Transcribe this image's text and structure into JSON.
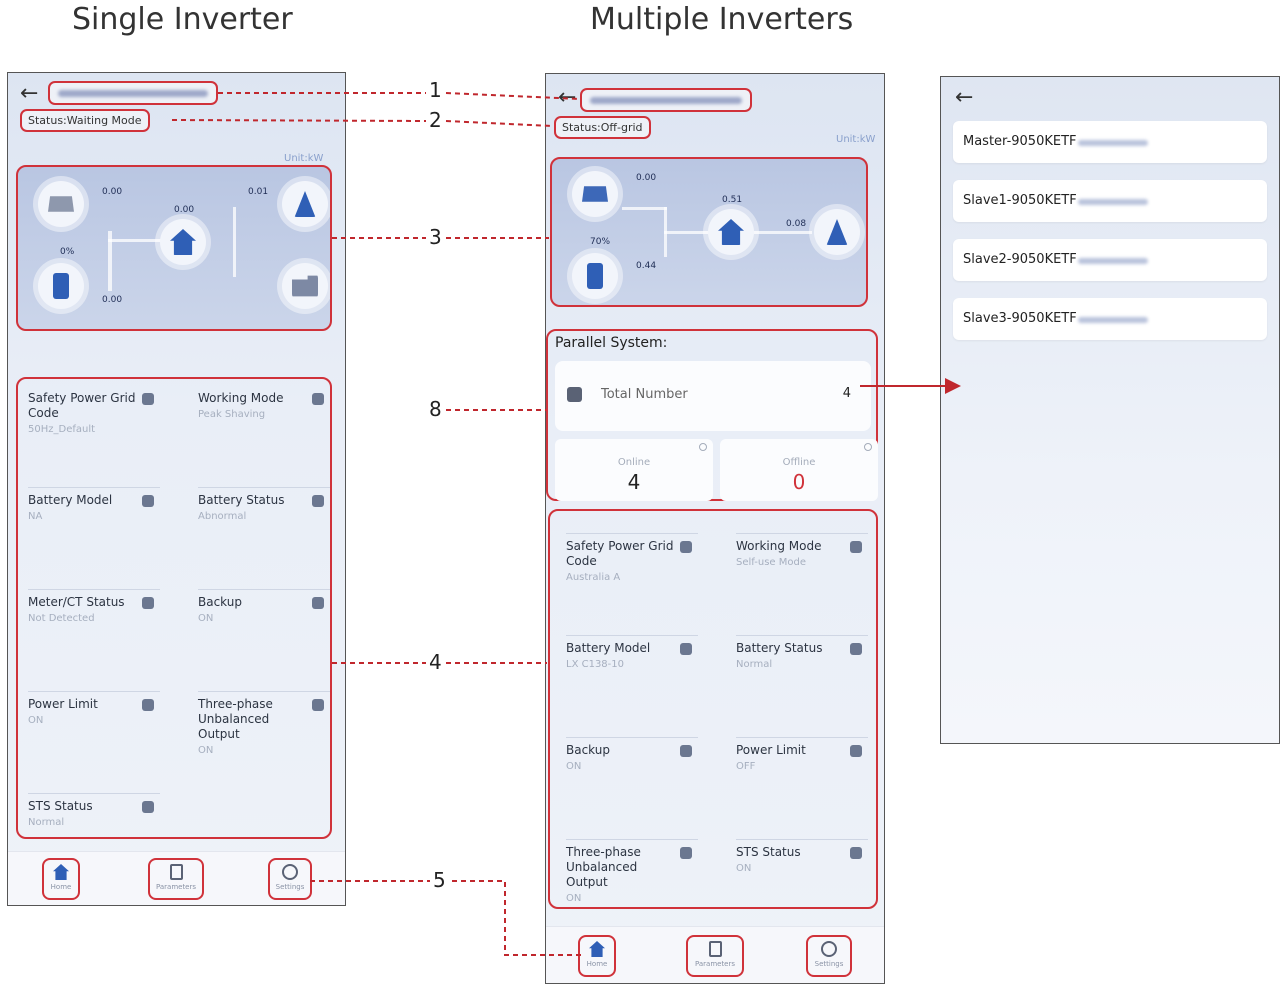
{
  "headings": {
    "single": "Single Inverter",
    "multiple": "Multiple Inverters"
  },
  "callouts": [
    "1",
    "2",
    "3",
    "8",
    "4",
    "5"
  ],
  "colors": {
    "highlight": "#d0323a",
    "accent": "#2f5fb6",
    "offline": "#d0323a"
  },
  "single": {
    "status": "Status:Waiting Mode",
    "unit": "Unit:kW",
    "flow": {
      "pv": "0.00",
      "grid": "0.01",
      "home": "0.00",
      "soc": "0%",
      "battery": "0.00"
    },
    "cards": [
      {
        "title": "Safety Power Grid Code",
        "value": "50Hz_Default",
        "icon": "shield-icon"
      },
      {
        "title": "Working Mode",
        "value": "Peak Shaving",
        "icon": "layers-icon"
      },
      {
        "title": "Battery Model",
        "value": "NA",
        "icon": "battery-icon"
      },
      {
        "title": "Battery Status",
        "value": "Abnormal",
        "icon": "battery-status-icon"
      },
      {
        "title": "Meter/CT Status",
        "value": "Not Detected",
        "icon": "meter-icon"
      },
      {
        "title": "Backup",
        "value": "ON",
        "icon": "backup-icon"
      },
      {
        "title": "Power Limit",
        "value": "ON",
        "icon": "power-limit-icon"
      },
      {
        "title": "Three-phase Unbalanced Output",
        "value": "ON",
        "icon": "three-phase-icon"
      },
      {
        "title": "STS Status",
        "value": "Normal",
        "icon": "sts-icon"
      }
    ],
    "tabs": [
      "Home",
      "Parameters",
      "Settings"
    ]
  },
  "multi": {
    "status": "Status:Off-grid",
    "unit": "Unit:kW",
    "flow": {
      "pv": "0.00",
      "soc": "70%",
      "battery": "0.44",
      "home": "0.51",
      "grid": "0.08"
    },
    "parallel": {
      "title": "Parallel System:",
      "total_label": "Total Number",
      "total_value": "4",
      "online_label": "Online",
      "online_value": "4",
      "offline_label": "Offline",
      "offline_value": "0"
    },
    "cards": [
      {
        "title": "Safety Power Grid Code",
        "value": "Australia A",
        "icon": "shield-icon"
      },
      {
        "title": "Working Mode",
        "value": "Self-use Mode",
        "icon": "layers-icon"
      },
      {
        "title": "Battery Model",
        "value": "LX C138-10",
        "icon": "battery-icon"
      },
      {
        "title": "Battery Status",
        "value": "Normal",
        "icon": "battery-status-icon"
      },
      {
        "title": "Backup",
        "value": "ON",
        "icon": "backup-icon"
      },
      {
        "title": "Power Limit",
        "value": "OFF",
        "icon": "power-limit-icon"
      },
      {
        "title": "Three-phase Unbalanced Output",
        "value": "ON",
        "icon": "three-phase-icon"
      },
      {
        "title": "STS Status",
        "value": "ON",
        "icon": "sts-icon"
      }
    ],
    "tabs": [
      "Home",
      "Parameters",
      "Settings"
    ]
  },
  "inverter_list": [
    "Master-9050KETF",
    "Slave1-9050KETF",
    "Slave2-9050KETF",
    "Slave3-9050KETF"
  ]
}
